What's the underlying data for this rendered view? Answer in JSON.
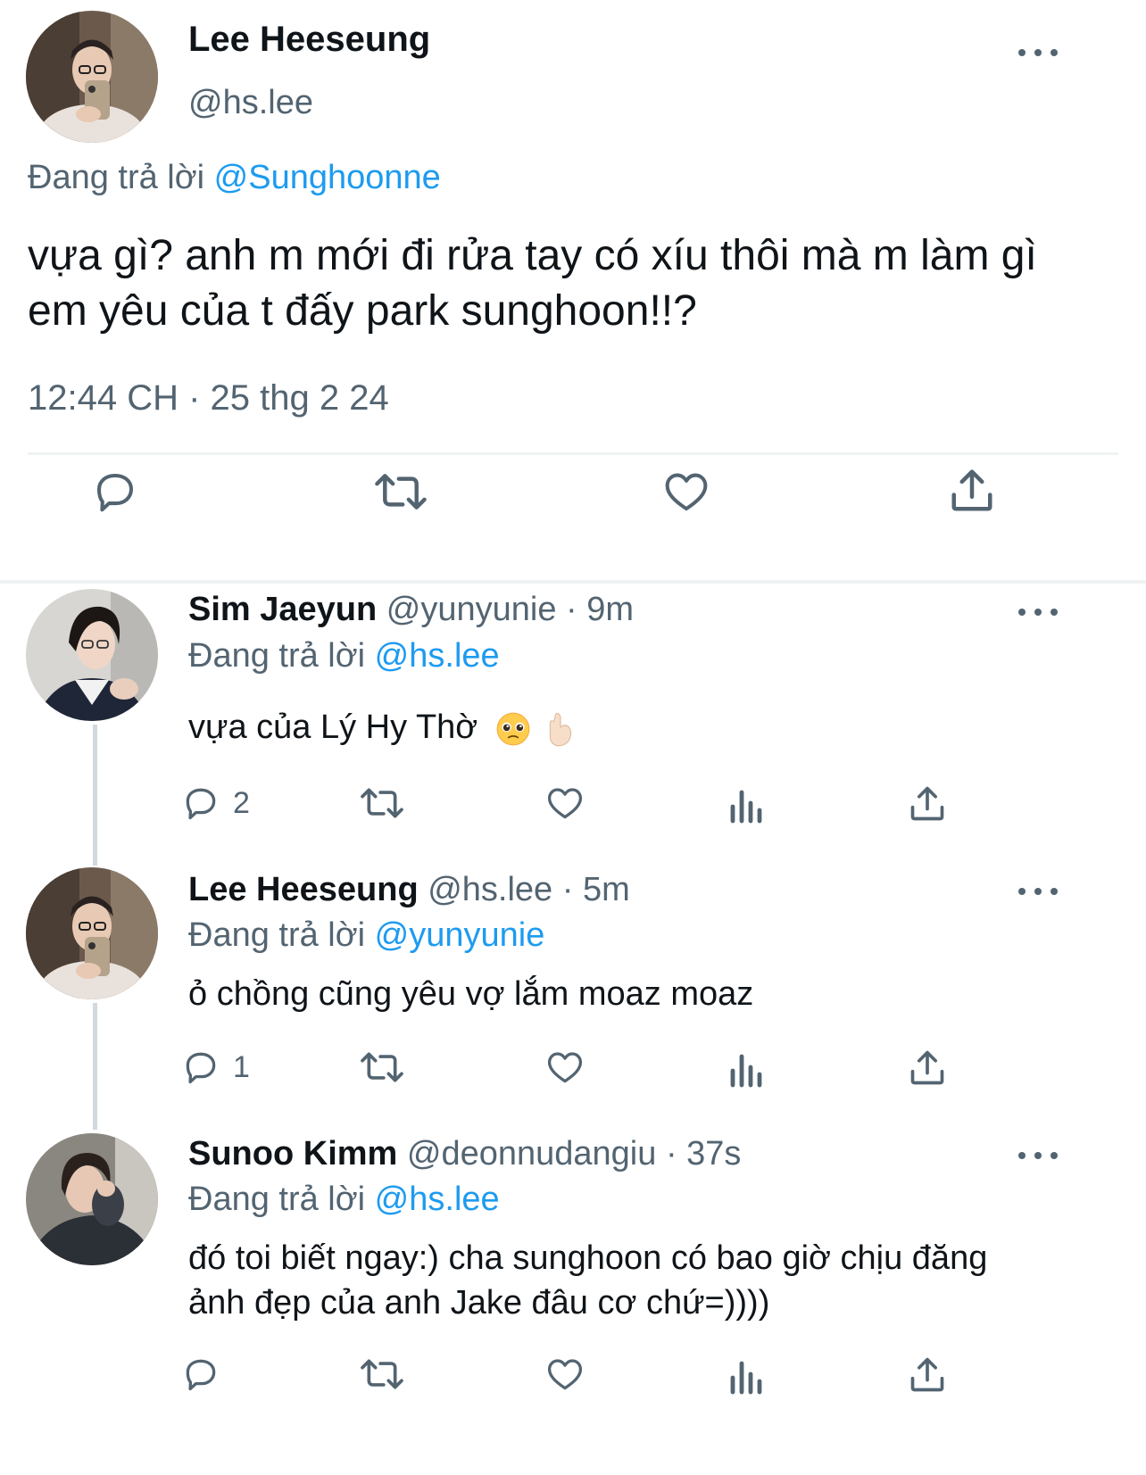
{
  "main_tweet": {
    "author_name": "Lee Heeseung",
    "author_handle": "@hs.lee",
    "replying_prefix": "Đang trả lời",
    "replying_to": "@Sunghoonne",
    "text": "vựa gì? anh m mới đi rửa tay có xíu thôi mà m làm gì em yêu của t đấy park sunghoon!!?",
    "timestamp": "12:44 CH · 25 thg 2 24",
    "actions": [
      "reply-icon",
      "retweet-icon",
      "like-icon",
      "share-icon"
    ]
  },
  "replies": [
    {
      "author_name": "Sim Jaeyun",
      "author_handle": "@yunyunie",
      "time": "· 9m",
      "replying_prefix": "Đang trả lời",
      "replying_to": "@hs.lee",
      "text": "vựa của Lý Hy Thờ",
      "emojis": [
        "pleading-face-emoji",
        "pinched-fingers-emoji"
      ],
      "reply_count": "2"
    },
    {
      "author_name": "Lee Heeseung",
      "author_handle": "@hs.lee",
      "time": "· 5m",
      "replying_prefix": "Đang trả lời",
      "replying_to": "@yunyunie",
      "text": "ỏ chồng cũng yêu vợ lắm moaz moaz",
      "reply_count": "1"
    },
    {
      "author_name": "Sunoo Kimm",
      "author_handle": "@deonnudangiu",
      "time": "· 37s",
      "replying_prefix": "Đang trả lời",
      "replying_to": "@hs.lee",
      "text": "đó toi biết ngay:) cha sunghoon có bao giờ chịu đăng ảnh đẹp của anh Jake đâu cơ chứ=))))",
      "reply_count": ""
    }
  ],
  "colors": {
    "link": "#1d9bf0",
    "muted": "#536471",
    "text": "#0f1419",
    "divider": "#eff3f4",
    "thread_line": "#cfd9de"
  }
}
